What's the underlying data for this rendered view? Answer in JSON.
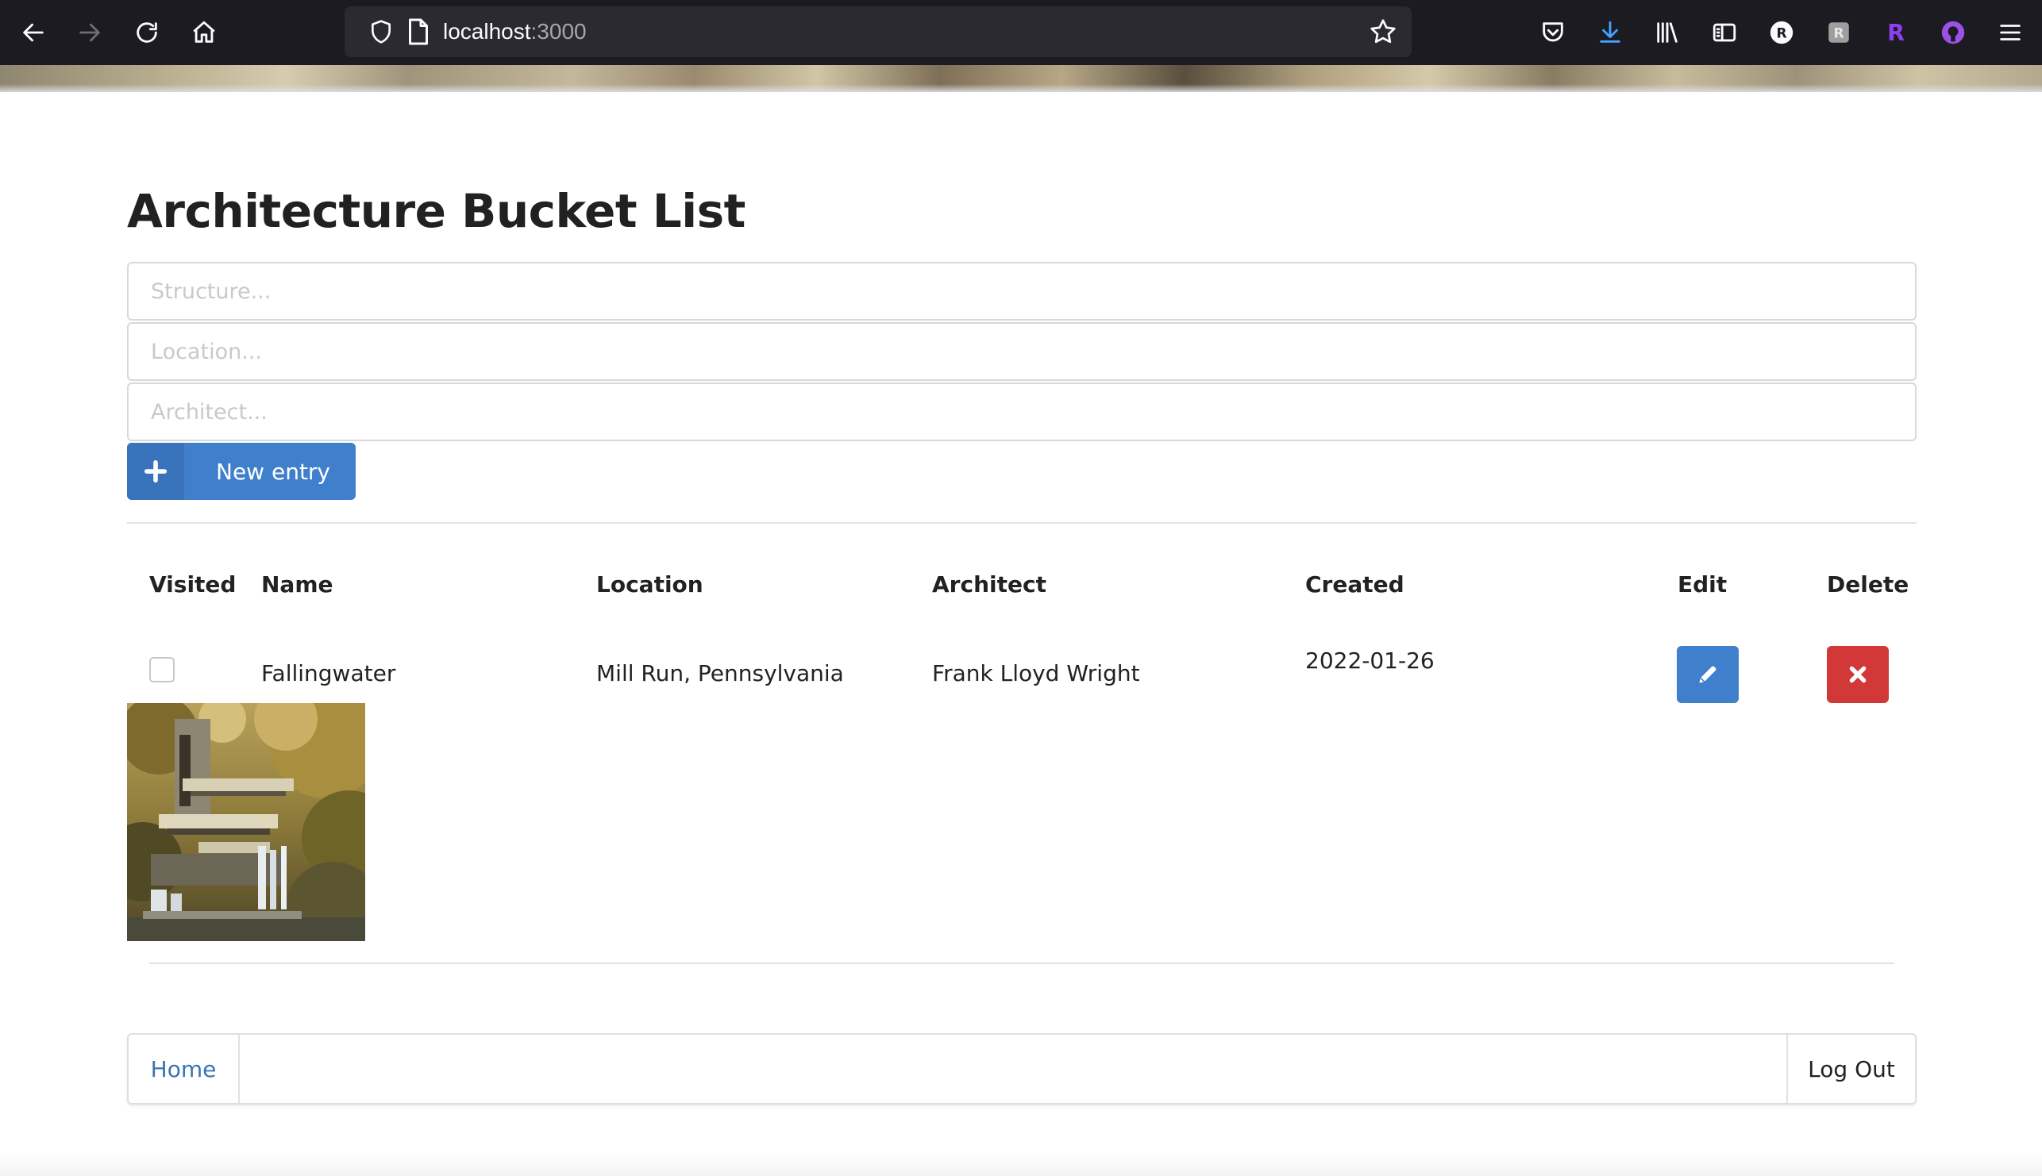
{
  "browser": {
    "url_host": "localhost",
    "url_port": ":3000"
  },
  "page": {
    "title": "Architecture Bucket List"
  },
  "form": {
    "structure_placeholder": "Structure...",
    "location_placeholder": "Location...",
    "architect_placeholder": "Architect...",
    "new_entry_label": "New entry"
  },
  "table": {
    "headers": {
      "visited": "Visited",
      "name": "Name",
      "location": "Location",
      "architect": "Architect",
      "created": "Created",
      "edit": "Edit",
      "delete": "Delete"
    },
    "rows": [
      {
        "visited": false,
        "name": "Fallingwater",
        "location": "Mill Run, Pennsylvania",
        "architect": "Frank Lloyd Wright",
        "created": "2022-01-26"
      }
    ]
  },
  "footer": {
    "home_label": "Home",
    "logout_label": "Log Out"
  },
  "icons": {
    "back": "arrow-left-icon",
    "forward": "arrow-right-icon",
    "reload": "reload-icon",
    "home": "home-icon",
    "bookmark": "star-icon",
    "pocket": "pocket-icon",
    "download": "download-icon",
    "library": "library-icon",
    "sidebar": "sidebar-icon",
    "extension_r": "extension-r-icon",
    "extension_2": "extension-icon",
    "extension_r2": "extension-r-purple-icon",
    "github": "github-icon",
    "menu": "hamburger-menu-icon",
    "plus": "plus-icon",
    "edit": "pencil-icon",
    "delete": "close-x-icon"
  },
  "colors": {
    "primary": "#3f7fcb",
    "danger": "#d23838",
    "link": "#3a73b5",
    "chrome_bg": "#1c1b22",
    "urlbar_bg": "#2b2a33"
  }
}
